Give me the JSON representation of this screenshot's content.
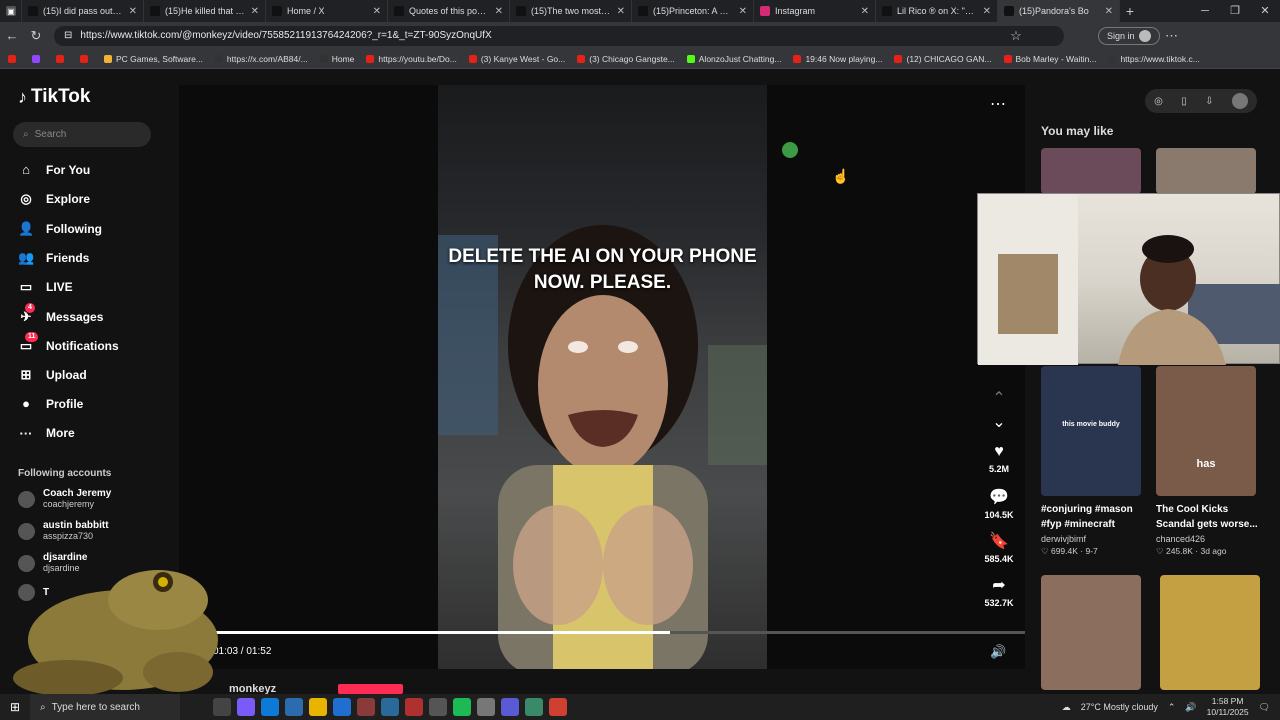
{
  "browser": {
    "tabs": [
      {
        "title": "(15)I did pass out early",
        "icon": "tiktok-icon",
        "color": "#111"
      },
      {
        "title": "(15)He killed that danc",
        "icon": "tiktok-icon",
        "color": "#111"
      },
      {
        "title": "Home / X",
        "icon": "x-icon",
        "color": "#111"
      },
      {
        "title": "Quotes of this post / X",
        "icon": "x-icon",
        "color": "#111"
      },
      {
        "title": "(15)The two most influ",
        "icon": "tiktok-icon",
        "color": "#111"
      },
      {
        "title": "(15)Princeton: A Heartw",
        "icon": "tiktok-icon",
        "color": "#111"
      },
      {
        "title": "Instagram",
        "icon": "instagram-icon",
        "color": "#d62976"
      },
      {
        "title": "Lil Rico ® on X: \"Bro is",
        "icon": "x-icon",
        "color": "#111"
      },
      {
        "title": "(15)Pandora's Bo",
        "icon": "tiktok-icon",
        "color": "#111"
      }
    ],
    "url": "https://www.tiktok.com/@monkeyz/video/7558521191376424206?_r=1&_t=ZT-90SyzOnqUfX",
    "signin_label": "Sign in",
    "bookmarks": [
      {
        "label": "",
        "color": "#e62117"
      },
      {
        "label": "",
        "color": "#9146ff"
      },
      {
        "label": "",
        "color": "#e62117"
      },
      {
        "label": "",
        "color": "#e62117"
      },
      {
        "label": "PC Games, Software...",
        "color": "#f2b134"
      },
      {
        "label": "https://x.com/AB84/...",
        "color": "#333"
      },
      {
        "label": "Home",
        "color": "#333"
      },
      {
        "label": "https://youtu.be/Do...",
        "color": "#e62117"
      },
      {
        "label": "(3) Kanye West - Go...",
        "color": "#e62117"
      },
      {
        "label": "(3) Chicago Gangste...",
        "color": "#e62117"
      },
      {
        "label": "AlonzoJust Chatting...",
        "color": "#53fc18"
      },
      {
        "label": "19:46 Now playing...",
        "color": "#e62117"
      },
      {
        "label": "(12) CHICAGO GAN...",
        "color": "#e62117"
      },
      {
        "label": "Bob Marley - Waitin...",
        "color": "#e62117"
      },
      {
        "label": "https://www.tiktok.c...",
        "color": "#333"
      }
    ]
  },
  "tiktok": {
    "logo": "TikTok",
    "search_placeholder": "Search",
    "nav": [
      {
        "label": "For You",
        "icon": "home-icon",
        "glyph": "⌂",
        "badge": ""
      },
      {
        "label": "Explore",
        "icon": "compass-icon",
        "glyph": "◎",
        "badge": ""
      },
      {
        "label": "Following",
        "icon": "following-icon",
        "glyph": "👤",
        "badge": ""
      },
      {
        "label": "Friends",
        "icon": "friends-icon",
        "glyph": "👥",
        "badge": ""
      },
      {
        "label": "LIVE",
        "icon": "live-icon",
        "glyph": "▭",
        "badge": ""
      },
      {
        "label": "Messages",
        "icon": "messages-icon",
        "glyph": "✈",
        "badge": "4"
      },
      {
        "label": "Notifications",
        "icon": "inbox-icon",
        "glyph": "▭",
        "badge": "11"
      },
      {
        "label": "Upload",
        "icon": "upload-icon",
        "glyph": "⊞",
        "badge": ""
      },
      {
        "label": "Profile",
        "icon": "profile-icon",
        "glyph": "●",
        "badge": ""
      },
      {
        "label": "More",
        "icon": "more-icon",
        "glyph": "···",
        "badge": ""
      }
    ],
    "following_header": "Following accounts",
    "following": [
      {
        "name": "Coach Jeremy",
        "handle": "coachjeremy"
      },
      {
        "name": "austin babbitt",
        "handle": "asspizza730"
      },
      {
        "name": "djsardine",
        "handle": "djsardine"
      },
      {
        "name": "T",
        "handle": ""
      }
    ],
    "video": {
      "caption": "DELETE THE AI ON YOUR PHONE NOW. PLEASE.",
      "time": "01:03 / 01:52",
      "progress": 0.5625,
      "author": "monkeyz",
      "likes": "5.2M",
      "comments": "104.5K",
      "saves": "585.4K",
      "shares": "532.7K"
    },
    "you_may_like": "You may like",
    "recommendations": [
      {
        "title": "#conjuring #mason #fyp #minecraft",
        "author": "derwivjbimf",
        "stats": "♡ 699.4K · 9-7",
        "thumb_text": "this movie buddy"
      },
      {
        "title": "The Cool Kicks Scandal gets worse...",
        "author": "chanced426",
        "stats": "♡ 245.8K · 3d ago",
        "thumb_text": "has"
      }
    ]
  },
  "taskbar": {
    "search_placeholder": "Type here to search",
    "weather": "27°C  Mostly cloudy",
    "time": "1:58 PM",
    "date": "10/11/2025"
  }
}
